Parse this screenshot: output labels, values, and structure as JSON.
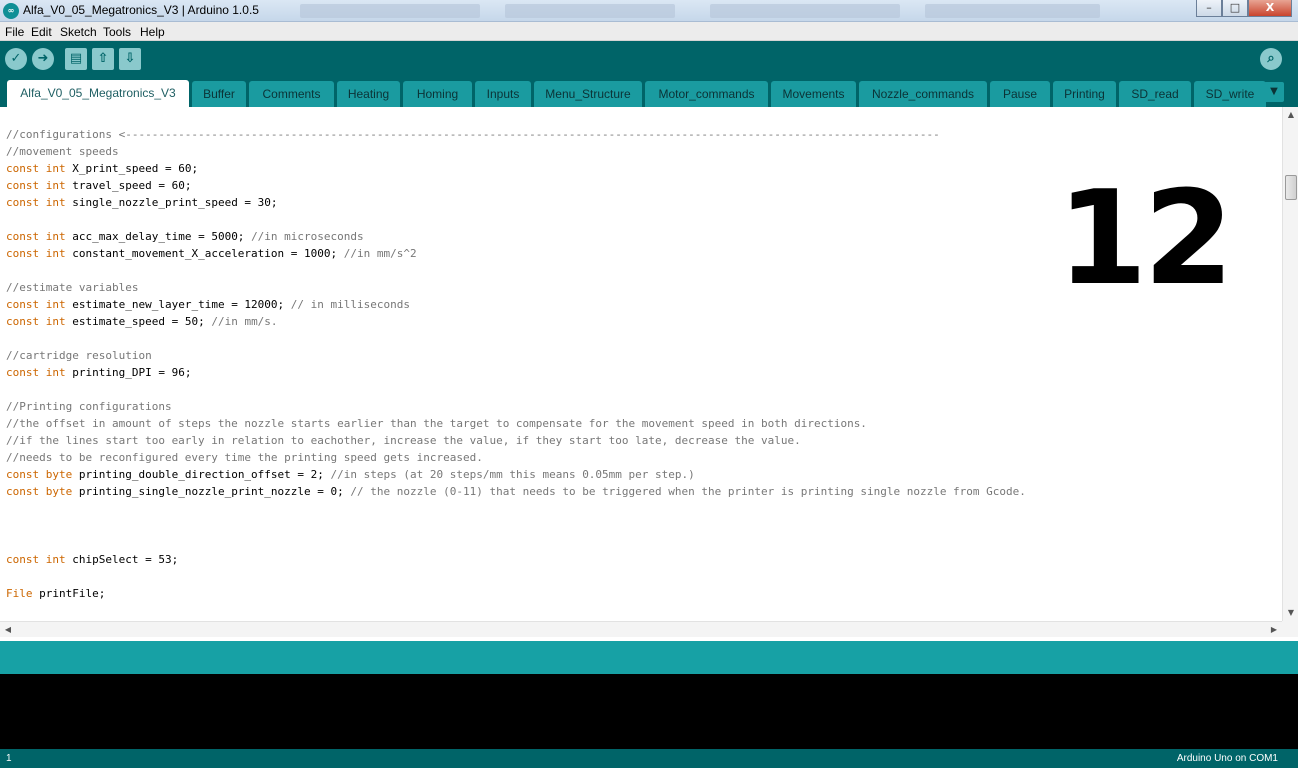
{
  "window": {
    "title": "Alfa_V0_05_Megatronics_V3 | Arduino 1.0.5",
    "icon": "arduino-logo-icon",
    "buttons": {
      "minimize": "–",
      "maximize": "□",
      "close": "X"
    }
  },
  "menu": [
    "File",
    "Edit",
    "Sketch",
    "Tools",
    "Help"
  ],
  "toolbar": {
    "verify_icon": "✓",
    "upload_icon": "➜",
    "new_icon": "▤",
    "open_icon": "⇧",
    "save_icon": "⇩",
    "serial_monitor_icon": "⌕"
  },
  "tabs": {
    "items": [
      {
        "label": "Alfa_V0_05_Megatronics_V3",
        "active": true
      },
      {
        "label": "Buffer"
      },
      {
        "label": "Comments"
      },
      {
        "label": "Heating"
      },
      {
        "label": "Homing"
      },
      {
        "label": "Inputs"
      },
      {
        "label": "Menu_Structure"
      },
      {
        "label": "Motor_commands"
      },
      {
        "label": "Movements"
      },
      {
        "label": "Nozzle_commands"
      },
      {
        "label": "Pause"
      },
      {
        "label": "Printing"
      },
      {
        "label": "SD_read"
      },
      {
        "label": "SD_write"
      }
    ],
    "menu_icon": "▼"
  },
  "code": [
    [
      {
        "t": "//configurations <---------------------------------------------------------------------------------------------------------------------------",
        "c": "cm"
      }
    ],
    [
      {
        "t": "//movement speeds",
        "c": "cm"
      }
    ],
    [
      {
        "t": "const",
        "c": "kw"
      },
      {
        "t": " "
      },
      {
        "t": "int",
        "c": "kw"
      },
      {
        "t": " X_print_speed = 60;"
      }
    ],
    [
      {
        "t": "const",
        "c": "kw"
      },
      {
        "t": " "
      },
      {
        "t": "int",
        "c": "kw"
      },
      {
        "t": " travel_speed = 60;"
      }
    ],
    [
      {
        "t": "const",
        "c": "kw"
      },
      {
        "t": " "
      },
      {
        "t": "int",
        "c": "kw"
      },
      {
        "t": " single_nozzle_print_speed = 30;"
      }
    ],
    [],
    [
      {
        "t": "const",
        "c": "kw"
      },
      {
        "t": " "
      },
      {
        "t": "int",
        "c": "kw"
      },
      {
        "t": " acc_max_delay_time = 5000; "
      },
      {
        "t": "//in microseconds",
        "c": "cm"
      }
    ],
    [
      {
        "t": "const",
        "c": "kw"
      },
      {
        "t": " "
      },
      {
        "t": "int",
        "c": "kw"
      },
      {
        "t": " constant_movement_X_acceleration = 1000; "
      },
      {
        "t": "//in mm/s^2",
        "c": "cm"
      }
    ],
    [],
    [
      {
        "t": "//estimate variables",
        "c": "cm"
      }
    ],
    [
      {
        "t": "const",
        "c": "kw"
      },
      {
        "t": " "
      },
      {
        "t": "int",
        "c": "kw"
      },
      {
        "t": " estimate_new_layer_time = 12000; "
      },
      {
        "t": "// in milliseconds",
        "c": "cm"
      }
    ],
    [
      {
        "t": "const",
        "c": "kw"
      },
      {
        "t": " "
      },
      {
        "t": "int",
        "c": "kw"
      },
      {
        "t": " estimate_speed = 50; "
      },
      {
        "t": "//in mm/s.",
        "c": "cm"
      }
    ],
    [],
    [
      {
        "t": "//cartridge resolution",
        "c": "cm"
      }
    ],
    [
      {
        "t": "const",
        "c": "kw"
      },
      {
        "t": " "
      },
      {
        "t": "int",
        "c": "kw"
      },
      {
        "t": " printing_DPI = 96;"
      }
    ],
    [],
    [
      {
        "t": "//Printing configurations",
        "c": "cm"
      }
    ],
    [
      {
        "t": "//the offset in amount of steps the nozzle starts earlier than the target to compensate for the movement speed in both directions.",
        "c": "cm"
      }
    ],
    [
      {
        "t": "//if the lines start too early in relation to eachother, increase the value, if they start too late, decrease the value.",
        "c": "cm"
      }
    ],
    [
      {
        "t": "//needs to be reconfigured every time the printing speed gets increased.",
        "c": "cm"
      }
    ],
    [
      {
        "t": "const",
        "c": "kw"
      },
      {
        "t": " "
      },
      {
        "t": "byte",
        "c": "kw"
      },
      {
        "t": " printing_double_direction_offset = 2; "
      },
      {
        "t": "//in steps (at 20 steps/mm this means 0.05mm per step.)",
        "c": "cm"
      }
    ],
    [
      {
        "t": "const",
        "c": "kw"
      },
      {
        "t": " "
      },
      {
        "t": "byte",
        "c": "kw"
      },
      {
        "t": " printing_single_nozzle_print_nozzle = 0; "
      },
      {
        "t": "// the nozzle (0-11) that needs to be triggered when the printer is printing single nozzle from Gcode.",
        "c": "cm"
      }
    ],
    [],
    [],
    [],
    [
      {
        "t": "const",
        "c": "kw"
      },
      {
        "t": " "
      },
      {
        "t": "int",
        "c": "kw"
      },
      {
        "t": " chipSelect = 53;"
      }
    ],
    [],
    [
      {
        "t": "File",
        "c": "kw"
      },
      {
        "t": " printFile;"
      }
    ]
  ],
  "overlay_number": "12",
  "scrollbars": {
    "up": "▲",
    "down": "▼",
    "left": "◀",
    "right": "▶"
  },
  "status": {
    "line_number": "1",
    "board": "Arduino Uno on COM1"
  }
}
